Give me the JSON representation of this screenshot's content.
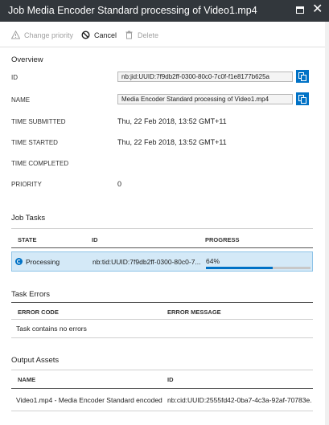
{
  "window": {
    "title": "Job Media Encoder Standard processing of Video1.mp4"
  },
  "toolbar": {
    "change_priority_label": "Change priority",
    "cancel_label": "Cancel",
    "delete_label": "Delete"
  },
  "overview": {
    "section_title": "Overview",
    "id_label": "ID",
    "id_value": "nb:jid:UUID:7f9db2ff-0300-80c0-7c0f-f1e8177b625a",
    "name_label": "NAME",
    "name_value": "Media Encoder Standard processing of Video1.mp4",
    "time_submitted_label": "TIME SUBMITTED",
    "time_submitted_value": "Thu, 22 Feb 2018, 13:52 GMT+11",
    "time_started_label": "TIME STARTED",
    "time_started_value": "Thu, 22 Feb 2018, 13:52 GMT+11",
    "time_completed_label": "TIME COMPLETED",
    "time_completed_value": "",
    "priority_label": "PRIORITY",
    "priority_value": "0"
  },
  "job_tasks": {
    "section_title": "Job Tasks",
    "columns": [
      "STATE",
      "ID",
      "PROGRESS"
    ],
    "rows": [
      {
        "state": "Processing",
        "id": "nb:tid:UUID:7f9db2ff-0300-80c0-7...",
        "progress_text": "64%",
        "progress_value": 0.64
      }
    ]
  },
  "task_errors": {
    "section_title": "Task Errors",
    "columns": [
      "ERROR CODE",
      "ERROR MESSAGE"
    ],
    "empty_text": "Task contains no errors"
  },
  "output_assets": {
    "section_title": "Output Assets",
    "columns": [
      "NAME",
      "ID"
    ],
    "rows": [
      {
        "name": "Video1.mp4 - Media Encoder Standard encoded",
        "id": "nb:cid:UUID:2555fd42-0ba7-4c3a-92af-70783e..."
      }
    ]
  },
  "colors": {
    "titlebar_bg": "#32373c",
    "accent": "#0072c6",
    "selected_row_bg": "#d4e9f7"
  },
  "icons": {
    "change_priority": "warning-triangle-icon",
    "cancel": "cancel-circle-icon",
    "delete": "trash-icon",
    "copy": "copy-icon",
    "processing": "processing-spinner-icon"
  }
}
